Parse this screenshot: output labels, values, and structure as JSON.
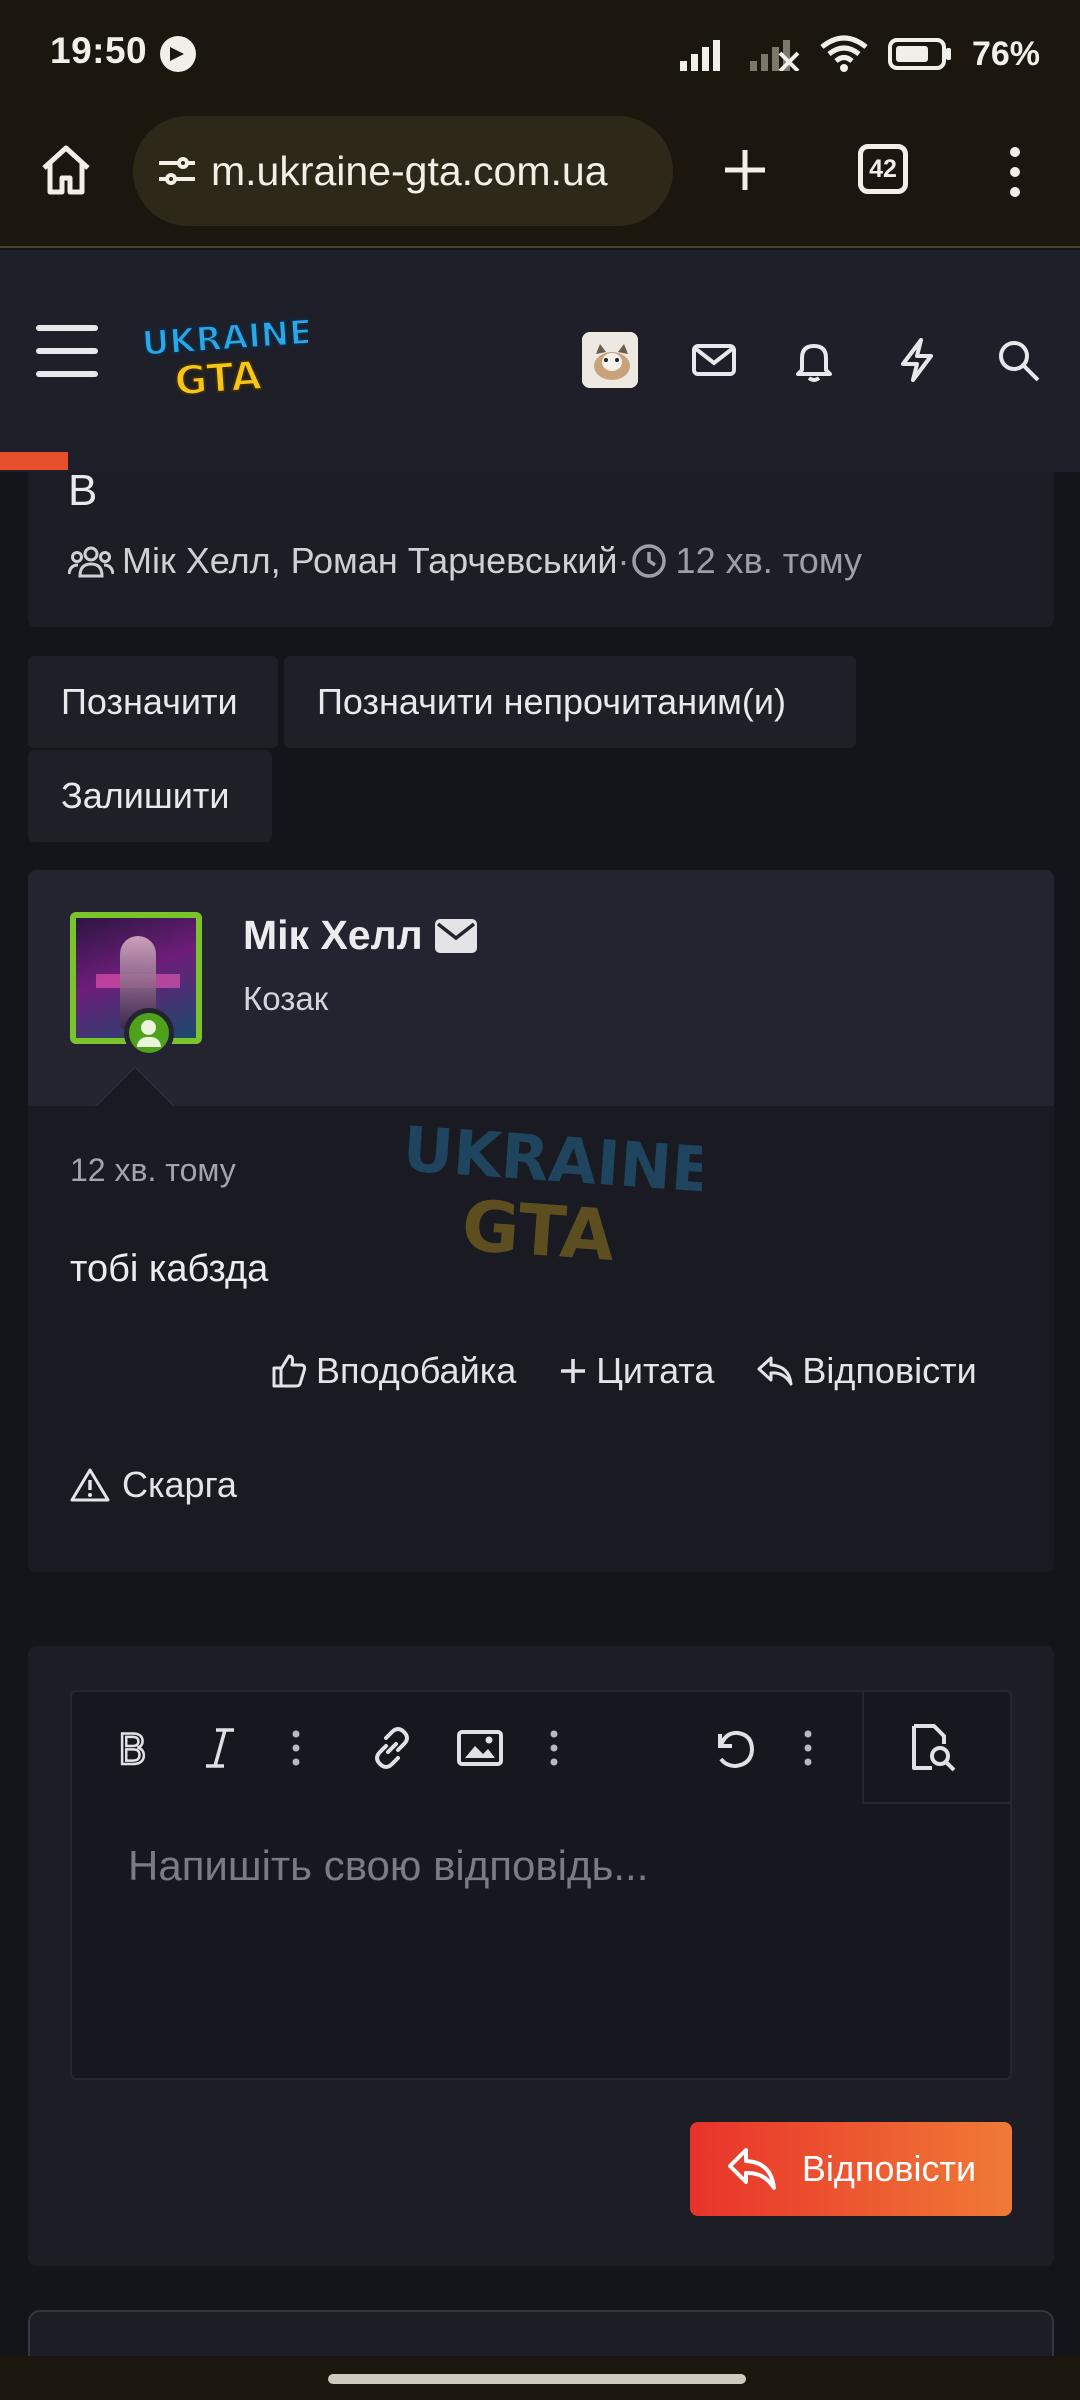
{
  "status_bar": {
    "time": "19:50",
    "battery_pct": "76%"
  },
  "browser": {
    "url": "m.ukraine-gta.com.ua",
    "tab_count": "42"
  },
  "site": {
    "logo_top": "UKRAINE",
    "logo_bottom": "GTA"
  },
  "thread_card": {
    "letter": "В",
    "participants": "Мік Хелл, Роман Тарчевський",
    "separator": " · ",
    "time": "12 хв. тому"
  },
  "actions": {
    "mark": "Позначити",
    "mark_unread": "Позначити непрочитаним(и)",
    "leave": "Залишити"
  },
  "message": {
    "author": "Мік Хелл",
    "author_title": "Козак",
    "time": "12 хв. тому",
    "text": "тобі кабзда",
    "like": "Вподобайка",
    "quote": "Цитата",
    "reply": "Відповісти",
    "report": "Скарга",
    "avatar_border_color": "#7bc32a"
  },
  "reply_form": {
    "placeholder": "Напишіть свою відповідь...",
    "submit": "Відповісти",
    "accent_gradient": [
      "#e8332a",
      "#f07a36"
    ]
  }
}
